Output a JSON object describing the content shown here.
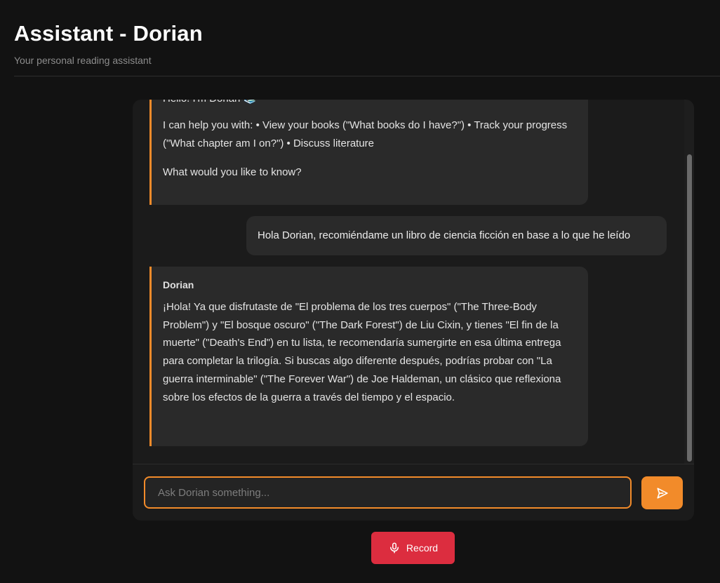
{
  "header": {
    "title": "Assistant - Dorian",
    "subtitle": "Your personal reading assistant"
  },
  "messages": [
    {
      "role": "assistant",
      "greeting": "Hello! I'm Dorian 📚",
      "help": "I can help you with: • View your books (\"What books do I have?\") • Track your progress (\"What chapter am I on?\") • Discuss literature",
      "question": "What would you like to know?"
    },
    {
      "role": "user",
      "text": "Hola Dorian, recomiéndame un libro de ciencia ficción en base a lo que he leído"
    },
    {
      "role": "assistant",
      "sender": "Dorian",
      "text": "¡Hola! Ya que disfrutaste de \"El problema de los tres cuerpos\" (\"The Three-Body Problem\") y \"El bosque oscuro\" (\"The Dark Forest\") de Liu Cixin, y tienes \"El fin de la muerte\" (\"Death's End\") en tu lista, te recomendaría sumergirte en esa última entrega para completar la trilogía. Si buscas algo diferente después, podrías probar con \"La guerra interminable\" (\"The Forever War\") de Joe Haldeman, un clásico que reflexiona sobre los efectos de la guerra a través del tiempo y el espacio."
    }
  ],
  "input": {
    "value": "",
    "placeholder": "Ask Dorian something..."
  },
  "icons": {
    "send": "send-icon",
    "record": "microphone-icon"
  },
  "record": {
    "label": "Record"
  },
  "colors": {
    "background": "#121212",
    "panel": "#1b1b1b",
    "bubble": "#2a2a2a",
    "accent": "#f28b2a",
    "record": "#dc2d3f"
  }
}
